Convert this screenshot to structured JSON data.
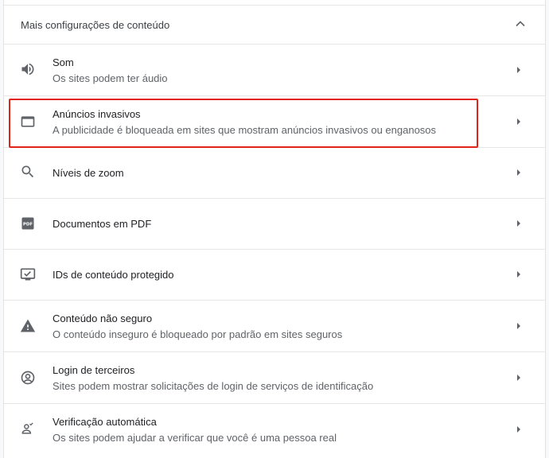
{
  "section": {
    "title": "Mais configurações de conteúdo",
    "expand_icon": "chevron-up-icon"
  },
  "items": [
    {
      "title": "Som",
      "subtitle": "Os sites podem ter áudio",
      "icon": "speaker-icon"
    },
    {
      "title": "Anúncios invasivos",
      "subtitle": "A publicidade é bloqueada em sites que mostram anúncios invasivos ou enganosos",
      "icon": "window-icon",
      "highlighted": true
    },
    {
      "title": "Níveis de zoom",
      "subtitle": "",
      "icon": "magnifier-icon"
    },
    {
      "title": "Documentos em PDF",
      "subtitle": "",
      "icon": "pdf-icon"
    },
    {
      "title": "IDs de conteúdo protegido",
      "subtitle": "",
      "icon": "monitor-check-icon"
    },
    {
      "title": "Conteúdo não seguro",
      "subtitle": "O conteúdo inseguro é bloqueado por padrão em sites seguros",
      "icon": "warning-icon"
    },
    {
      "title": "Login de terceiros",
      "subtitle": "Sites podem mostrar solicitações de login de serviços de identificação",
      "icon": "account-circle-icon"
    },
    {
      "title": "Verificação automática",
      "subtitle": "Os sites podem ajudar a verificar que você é uma pessoa real",
      "icon": "person-check-icon"
    }
  ],
  "pdf_icon_text": "PDF",
  "colors": {
    "highlight": "#e2231a",
    "icon": "#5f6368",
    "divider": "#e6e6e6"
  }
}
